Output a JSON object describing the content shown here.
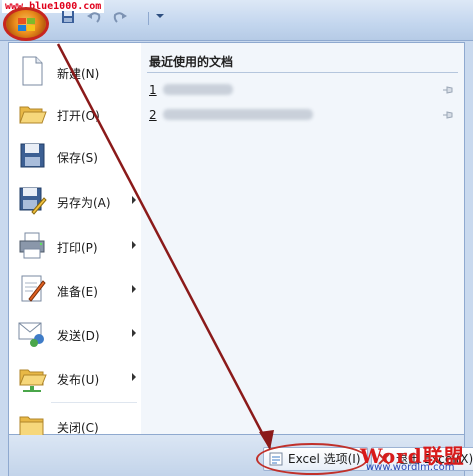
{
  "watermark": "www.blue1000.com",
  "quick_access": {
    "save_icon": "save-icon",
    "undo_icon": "undo-icon",
    "redo_icon": "redo-icon",
    "customize_icon": "chevron-down-icon"
  },
  "commands": [
    {
      "label": "新建(N)",
      "icon": "new-document-icon",
      "submenu": false
    },
    {
      "label": "打开(O)",
      "icon": "open-folder-icon",
      "submenu": false
    },
    {
      "label": "保存(S)",
      "icon": "save-icon",
      "submenu": false
    },
    {
      "label": "另存为(A)",
      "icon": "save-as-icon",
      "submenu": true
    },
    {
      "label": "打印(P)",
      "icon": "print-icon",
      "submenu": true
    },
    {
      "label": "准备(E)",
      "icon": "prepare-icon",
      "submenu": true
    },
    {
      "label": "发送(D)",
      "icon": "send-icon",
      "submenu": true
    },
    {
      "label": "发布(U)",
      "icon": "publish-icon",
      "submenu": true
    },
    {
      "label": "关闭(C)",
      "icon": "close-folder-icon",
      "submenu": false
    }
  ],
  "recent": {
    "title": "最近使用的文档",
    "items": [
      {
        "number": "1",
        "name": "blurred"
      },
      {
        "number": "2",
        "name": "blurred"
      }
    ]
  },
  "footer": {
    "options_label": "Excel 选项(I)",
    "exit_label": "退出 Excel(X)"
  },
  "brand": {
    "logo_text": "Word联盟",
    "url": "www.wordlm.com"
  },
  "colors": {
    "annotation_red": "#c0302a",
    "arrow_red": "#8b1a1a",
    "brand_red": "#d81a1a",
    "brand_blue": "#2848b8"
  }
}
